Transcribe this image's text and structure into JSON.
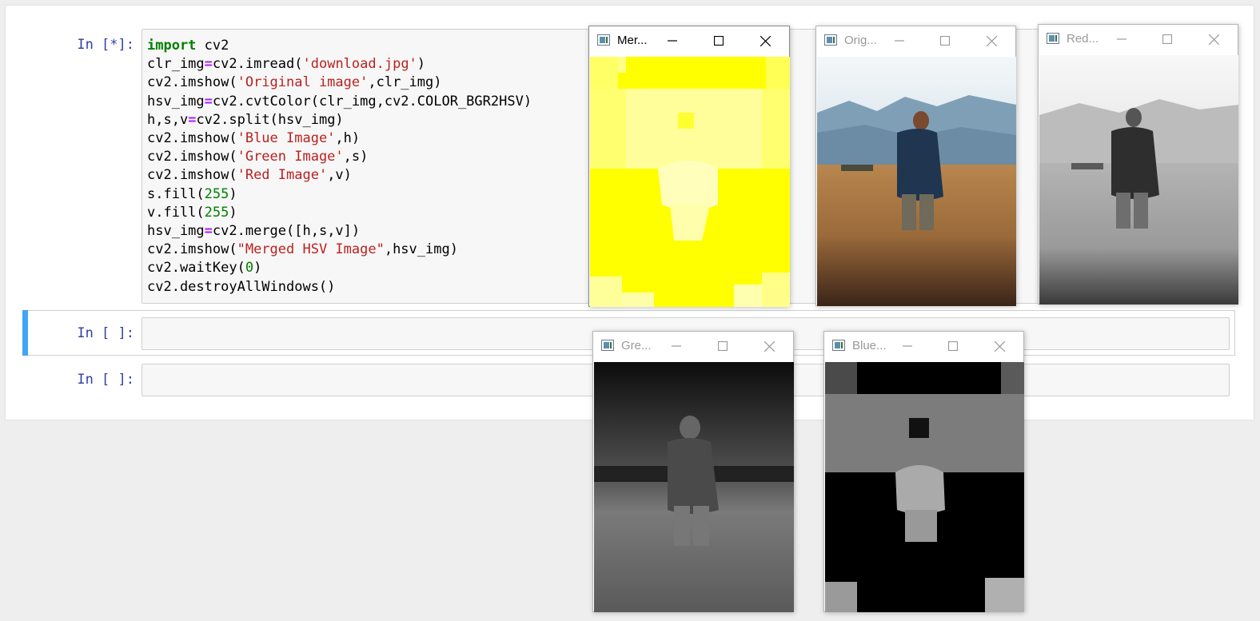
{
  "notebook": {
    "cells": [
      {
        "prompt": "In [*]:",
        "code_lines": [
          "import cv2",
          "clr_img=cv2.imread('download.jpg')",
          "cv2.imshow('Original image',clr_img)",
          "hsv_img=cv2.cvtColor(clr_img,cv2.COLOR_BGR2HSV)",
          "h,s,v=cv2.split(hsv_img)",
          "cv2.imshow('Blue Image',h)",
          "cv2.imshow('Green Image',s)",
          "cv2.imshow('Red Image',v)",
          "s.fill(255)",
          "v.fill(255)",
          "hsv_img=cv2.merge([h,s,v])",
          "cv2.imshow(\"Merged HSV Image\",hsv_img)",
          "cv2.waitKey(0)",
          "cv2.destroyAllWindows()"
        ]
      },
      {
        "prompt": "In [ ]:",
        "code_lines": []
      },
      {
        "prompt": "In [ ]:",
        "code_lines": []
      }
    ]
  },
  "windows": [
    {
      "id": "merged",
      "title": "Mer...",
      "active": true,
      "content": "yellow hue image"
    },
    {
      "id": "original",
      "title": "Orig...",
      "active": false,
      "content": "color photo of man in field"
    },
    {
      "id": "red",
      "title": "Red...",
      "active": false,
      "content": "grayscale value channel"
    },
    {
      "id": "green",
      "title": "Gre...",
      "active": false,
      "content": "grayscale saturation channel"
    },
    {
      "id": "blue",
      "title": "Blue...",
      "active": false,
      "content": "grayscale hue channel"
    }
  ],
  "icons": {
    "app": "opencv-window-icon",
    "minimize": "minimize-icon",
    "maximize": "maximize-icon",
    "close": "close-icon"
  },
  "colors": {
    "prompt": "#303f9f",
    "keyword": "#008000",
    "string": "#ba2121",
    "operator": "#aa22ff",
    "selected_cell_bar": "#42a5f5",
    "merged_yellow": "#ffff00"
  }
}
